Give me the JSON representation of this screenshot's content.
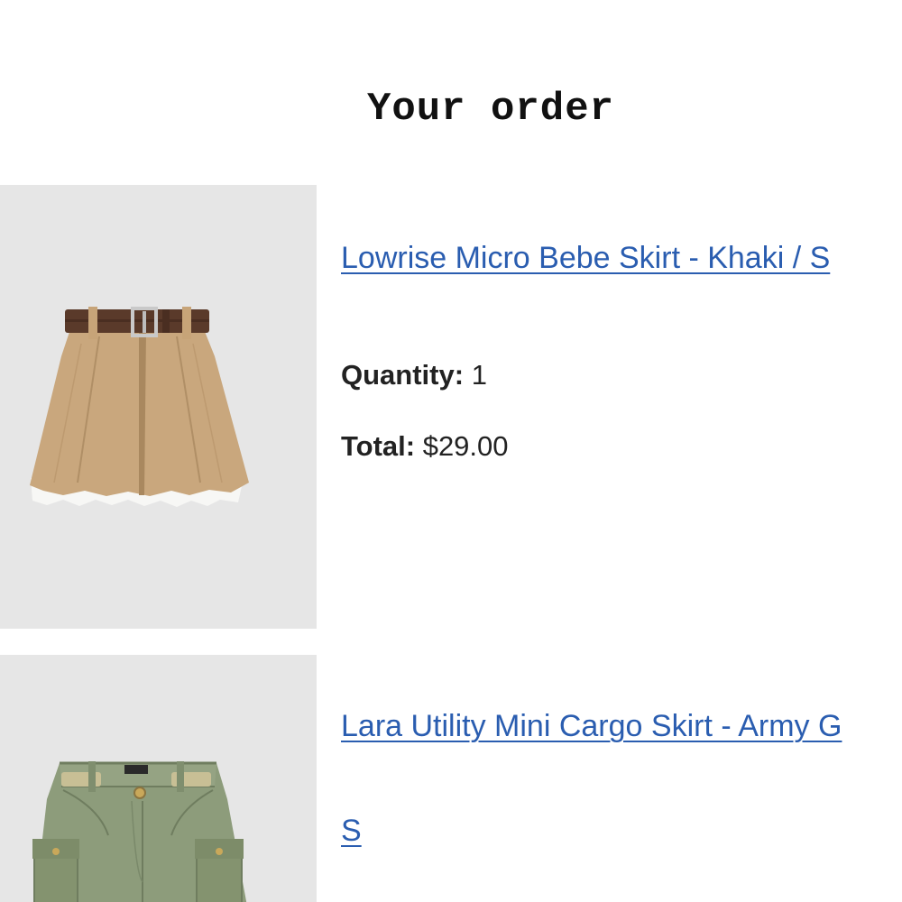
{
  "page": {
    "title": "Your order"
  },
  "items": [
    {
      "title": "Lowrise Micro Bebe Skirt - Khaki / S",
      "quantity_label": "Quantity:",
      "quantity": "1",
      "total_label": "Total:",
      "total": "$29.00",
      "image": "khaki-belted-micro-skirt"
    },
    {
      "title_line1": "Lara Utility Mini Cargo Skirt - Army G",
      "title_line2": "S",
      "image": "army-green-cargo-skirt"
    }
  ],
  "colors": {
    "link": "#2a5db0",
    "image_background": "#e6e6e6",
    "khaki": "#c9a77d",
    "belt": "#5a3a2a",
    "army_green": "#8d9c7b"
  }
}
